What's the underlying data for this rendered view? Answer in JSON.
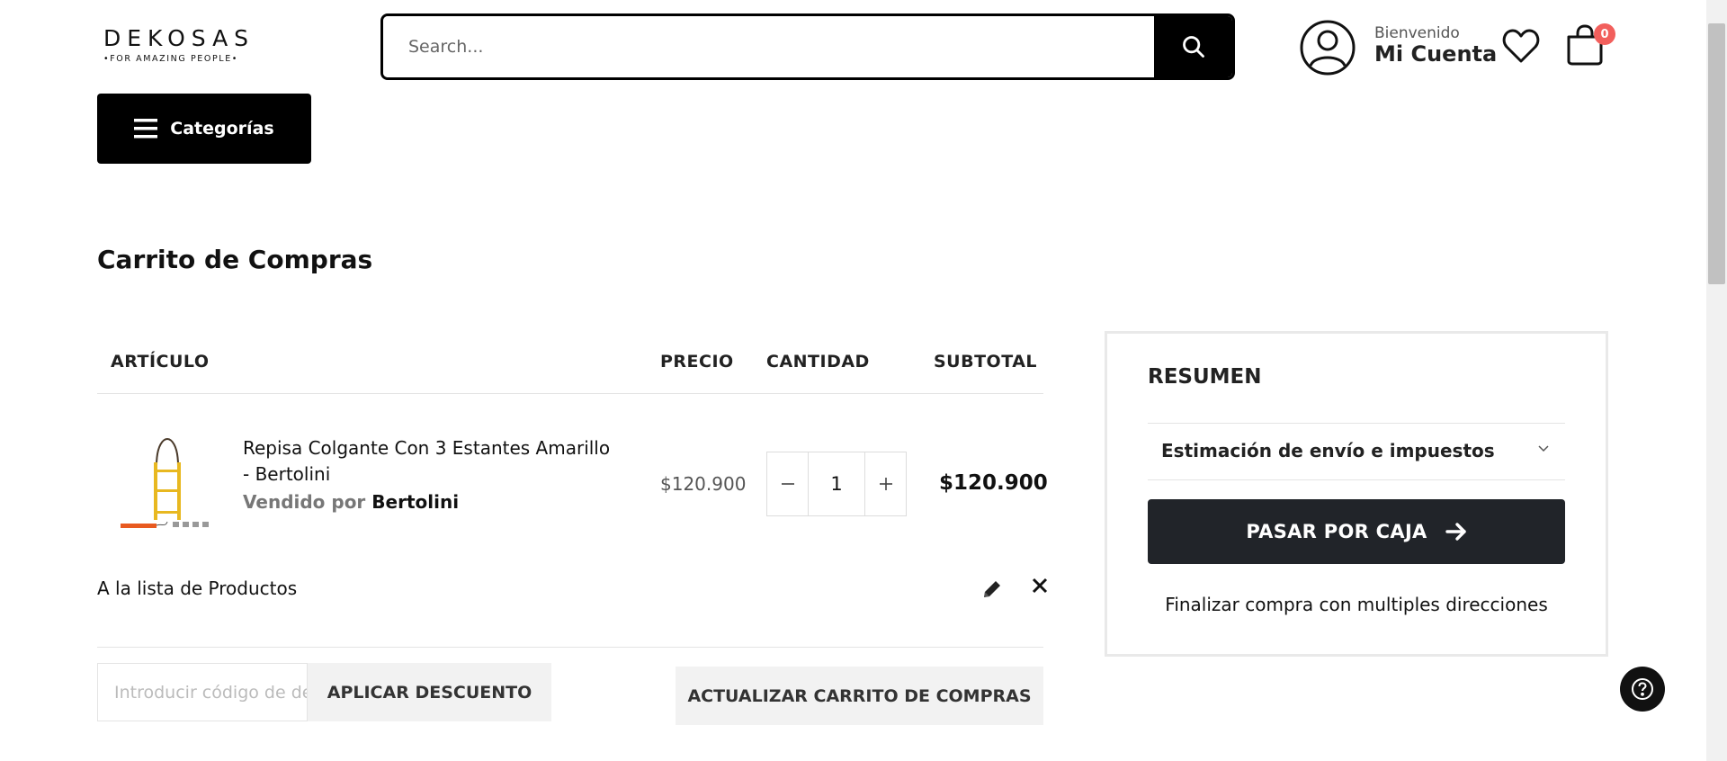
{
  "header": {
    "logo_text": "DEKOSAS",
    "logo_tagline": "•FOR AMAZING PEOPLE•",
    "search_placeholder": "Search...",
    "welcome": "Bienvenido",
    "account": "Mi Cuenta",
    "cart_count": "0",
    "categories_label": "Categorías"
  },
  "cart": {
    "title": "Carrito de Compras",
    "columns": {
      "article": "ARTÍCULO",
      "price": "PRECIO",
      "quantity": "CANTIDAD",
      "subtotal": "SUBTOTAL"
    },
    "item": {
      "name": "Repisa Colgante Con 3 Estantes Amarillo - Bertolini",
      "sold_by_label": "Vendido por",
      "seller": "Bertolini",
      "price": "$120.900",
      "qty": "1",
      "subtotal": "$120.900",
      "move_link": "A la lista de Productos"
    },
    "coupon_placeholder": "Introducir código de descuento",
    "apply_label": "APLICAR DESCUENTO",
    "update_label": "ACTUALIZAR CARRITO DE COMPRAS"
  },
  "summary": {
    "title": "RESUMEN",
    "shipping_label": "Estimación de envío e impuestos",
    "checkout_label": "PASAR POR CAJA",
    "multi_address": "Finalizar compra con multiples direcciones"
  },
  "icons": {
    "search": "search-icon",
    "account": "user-circle-icon",
    "wishlist": "heart-icon",
    "cart": "shopping-bag-icon",
    "menu": "hamburger-icon",
    "edit": "pencil-icon",
    "remove": "close-icon",
    "checkout": "arrow-right-icon",
    "help": "question-icon"
  },
  "colors": {
    "primary": "#000000",
    "checkout_bg": "#212429",
    "badge": "#f25f5c",
    "product_yellow": "#e8b820"
  }
}
